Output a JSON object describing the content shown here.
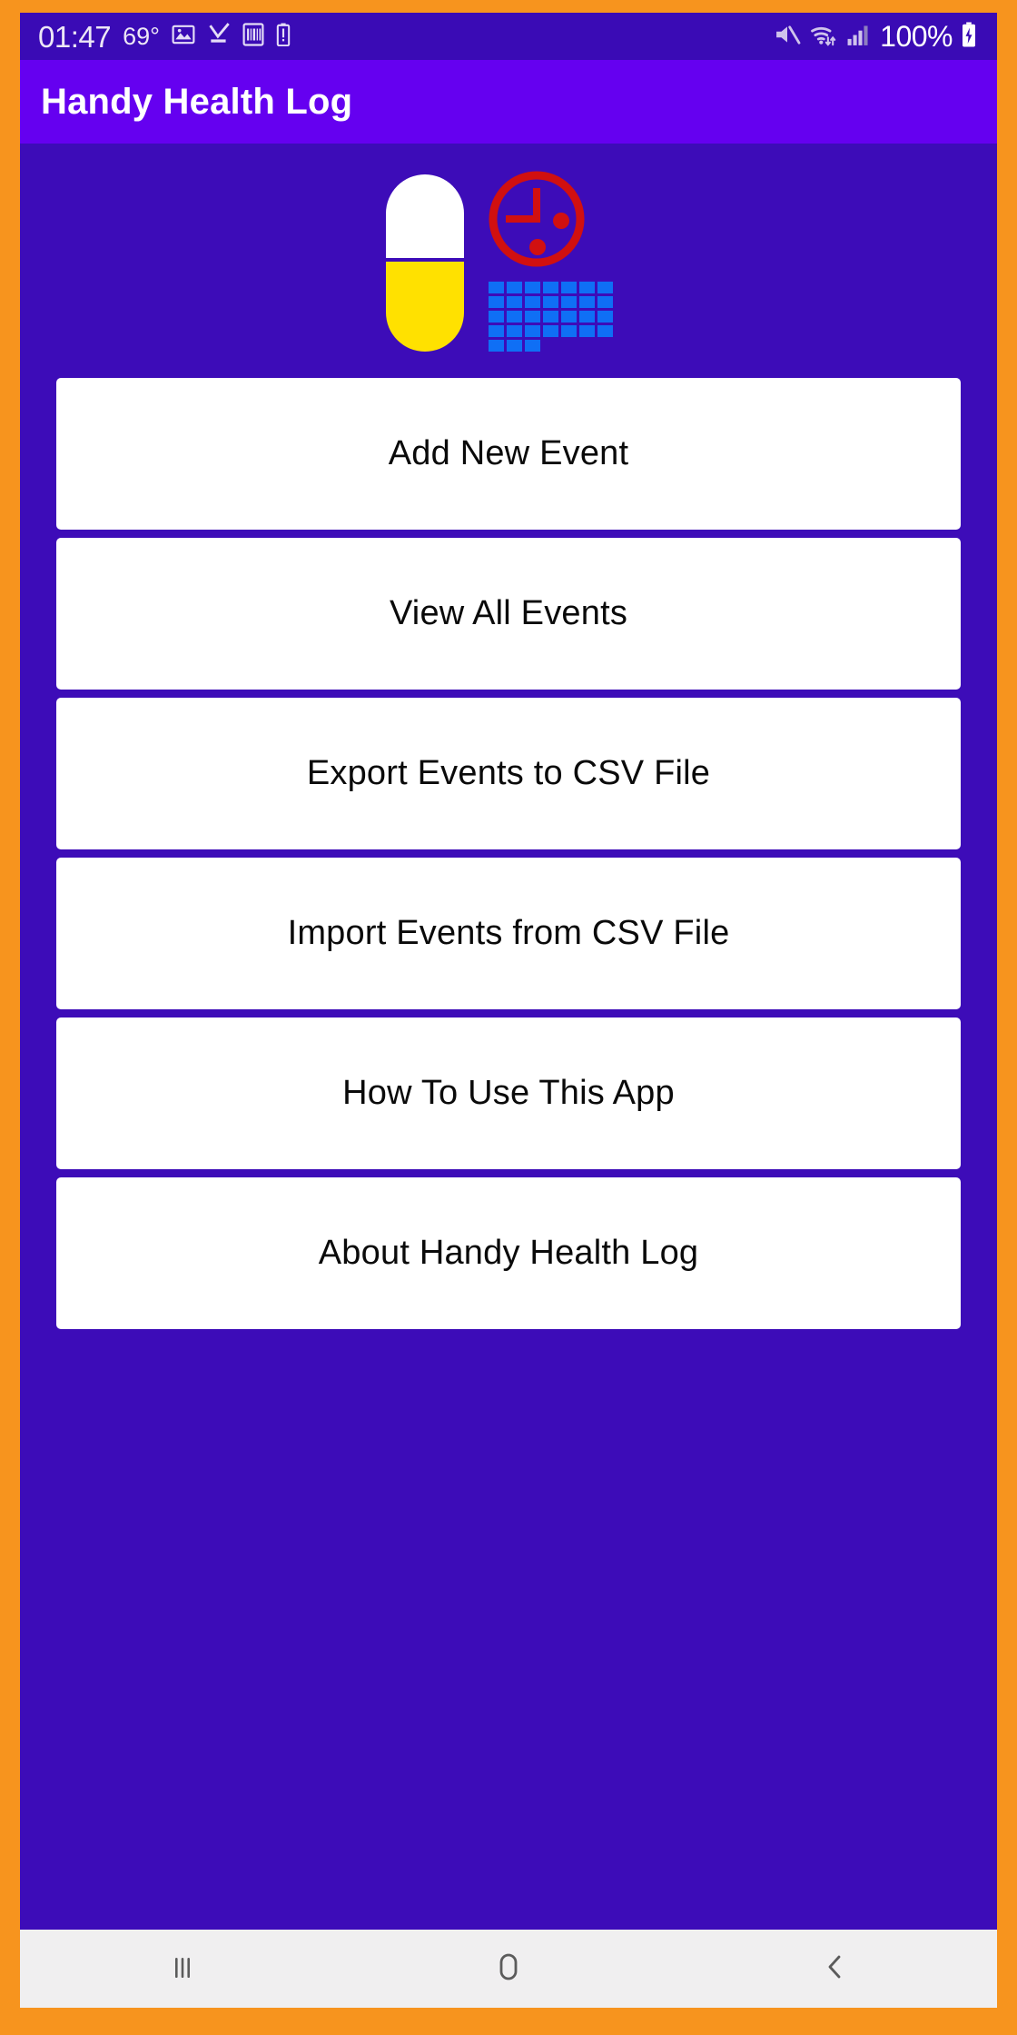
{
  "theme": {
    "frame_color": "#F7941E",
    "status_bar_color": "#3A0BB5",
    "app_bar_color": "#6500F0",
    "body_color": "#3D0CB8",
    "button_bg": "#FFFFFF",
    "button_text": "#0A0A0A",
    "nav_bar_color": "#F0EFF0",
    "logo_pill_top": "#FFFFFF",
    "logo_pill_bottom": "#FFE100",
    "logo_clock": "#D11010",
    "logo_calendar": "#0F6FF5"
  },
  "status_bar": {
    "time": "01:47",
    "temperature": "69°",
    "battery_percent": "100%",
    "icons_left": [
      "photo-icon",
      "download-complete-icon",
      "app-badge-icon",
      "battery-saver-icon"
    ],
    "icons_right": [
      "mute-icon",
      "wifi-icon",
      "cellular-signal-icon",
      "battery-charging-icon"
    ]
  },
  "app_bar": {
    "title": "Handy Health Log"
  },
  "logo": {
    "name": "app-logo",
    "parts": [
      "pill-capsule-icon",
      "clock-icon",
      "calendar-grid-icon"
    ],
    "calendar_rows": 5,
    "calendar_cols": 7,
    "calendar_last_row_cells": 3
  },
  "menu": {
    "buttons": [
      {
        "id": "add-new-event",
        "label": "Add New Event"
      },
      {
        "id": "view-all-events",
        "label": "View All Events"
      },
      {
        "id": "export-events-csv",
        "label": "Export Events to CSV File"
      },
      {
        "id": "import-events-csv",
        "label": "Import Events from CSV File"
      },
      {
        "id": "how-to-use",
        "label": "How To Use This App"
      },
      {
        "id": "about",
        "label": "About Handy Health Log"
      }
    ]
  },
  "nav_bar": {
    "recents_label": "Recent apps",
    "home_label": "Home",
    "back_label": "Back"
  }
}
